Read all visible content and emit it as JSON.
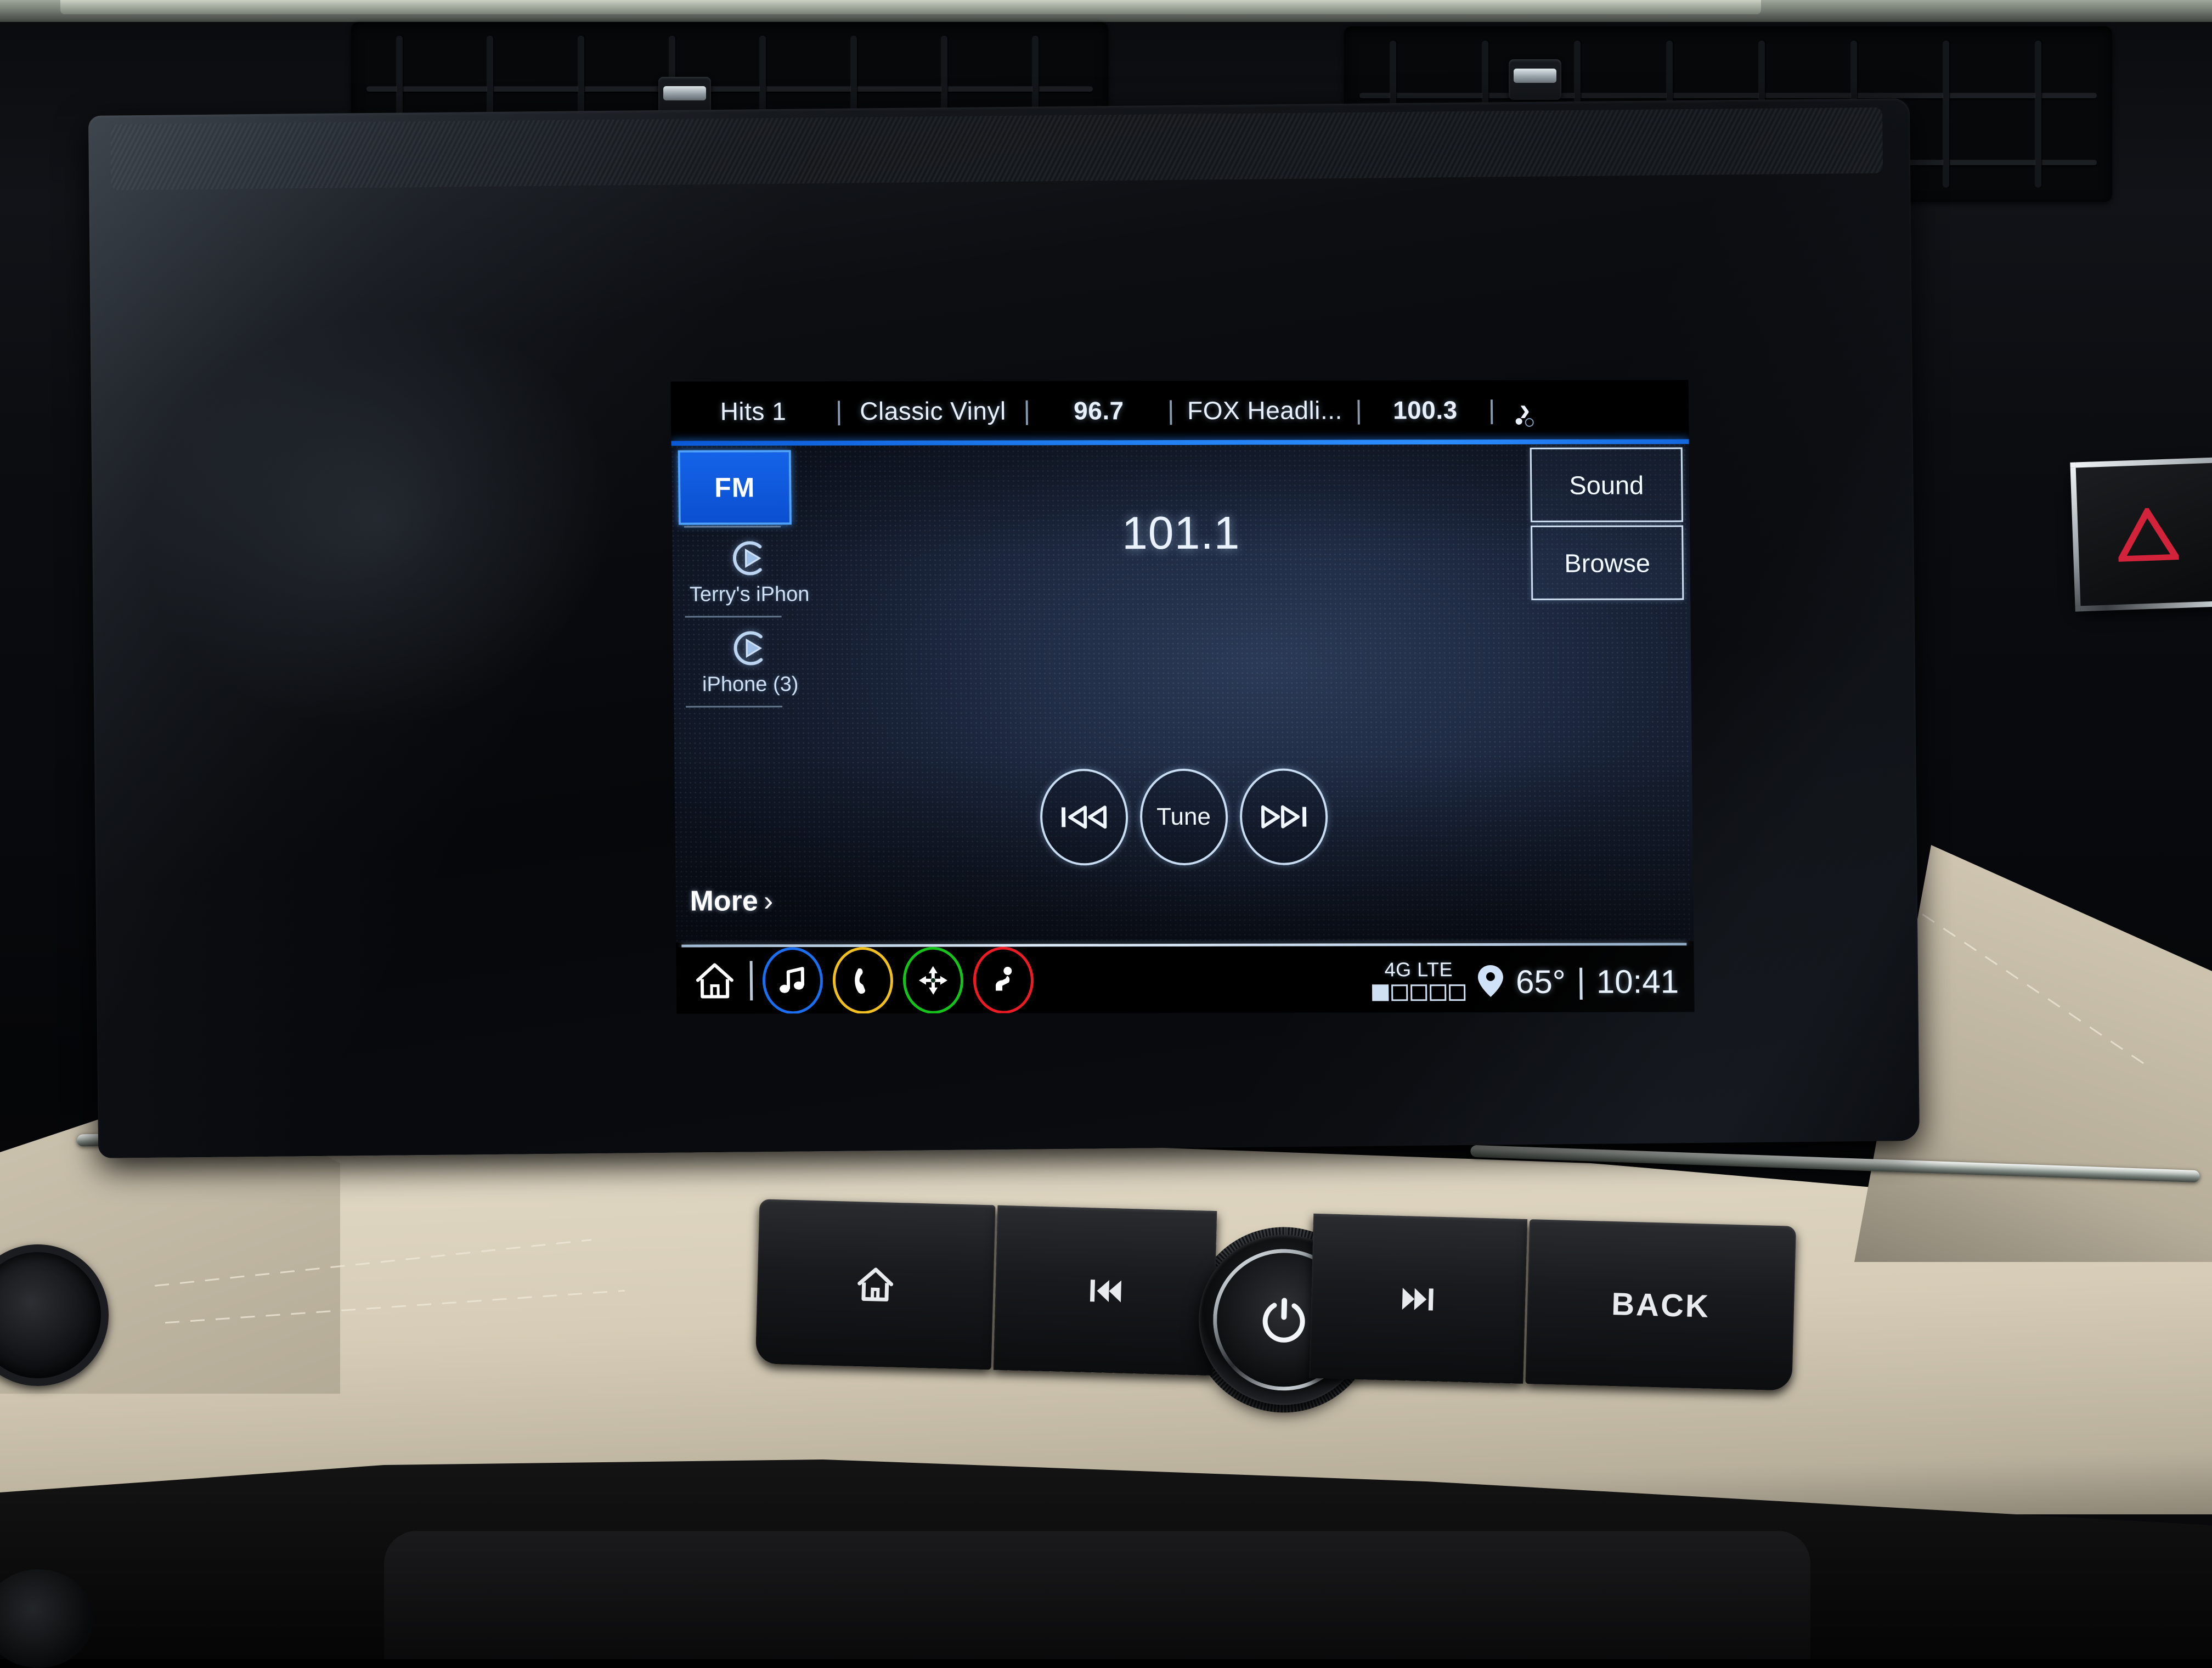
{
  "device": {
    "label": "Buick infotainment touchscreen"
  },
  "screen": {
    "presets": [
      {
        "label": "Hits 1"
      },
      {
        "label": "Classic Vinyl"
      },
      {
        "label": "96.7"
      },
      {
        "label": "FOX Headli..."
      },
      {
        "label": "100.3"
      }
    ],
    "preset_page_next_icon": "chevron-right-icon",
    "page_dots": {
      "total": 2,
      "active": 1
    },
    "source_column": {
      "active_source": "FM",
      "items": [
        {
          "label": "Terry's iPhon",
          "icon": "bluetooth-audio-play-icon"
        },
        {
          "label": "iPhone (3)",
          "icon": "bluetooth-audio-play-icon"
        }
      ],
      "more_label": "More",
      "more_chevron": "›"
    },
    "now_playing": {
      "frequency": "101.1",
      "band": "FM"
    },
    "side_buttons": [
      {
        "label": "Sound"
      },
      {
        "label": "Browse"
      }
    ],
    "transport": [
      {
        "name": "previous",
        "icon": "skip-previous-icon"
      },
      {
        "name": "tune",
        "label": "Tune"
      },
      {
        "name": "next",
        "icon": "skip-next-icon"
      }
    ],
    "taskbar": {
      "icons": [
        {
          "name": "home-icon",
          "color": "#ffffff"
        },
        {
          "name": "music-note-icon",
          "color": "#1a6ef0"
        },
        {
          "name": "phone-icon",
          "color": "#f2c01e"
        },
        {
          "name": "navigation-icon",
          "color": "#15c41a"
        },
        {
          "name": "onstar-emergency-icon",
          "color": "#ef1b24"
        }
      ]
    },
    "status_bar": {
      "network": "4G LTE",
      "signal": {
        "total": 5,
        "filled": 1
      },
      "location_icon": "map-pin-icon",
      "temperature": "65°",
      "separator": "|",
      "time": "10:41"
    },
    "colors": {
      "accent_blue": "#1563e8",
      "accent_blue_glow": "#2b8dff",
      "screen_bg": "#1e2a42",
      "text": "#eaf3fd"
    }
  },
  "hardware_panel": {
    "buttons": [
      {
        "name": "home-button",
        "icon": "home-icon"
      },
      {
        "name": "previous-track-button",
        "icon": "skip-previous-icon"
      },
      {
        "name": "power-volume-knob",
        "icon": "power-icon"
      },
      {
        "name": "next-track-button",
        "icon": "skip-next-icon"
      },
      {
        "name": "back-button",
        "label": "BACK"
      }
    ]
  },
  "dashboard": {
    "hazard_button": {
      "name": "hazard-button",
      "icon": "hazard-triangle-icon",
      "color": "#d3233a"
    },
    "vents": {
      "count": 2
    }
  }
}
